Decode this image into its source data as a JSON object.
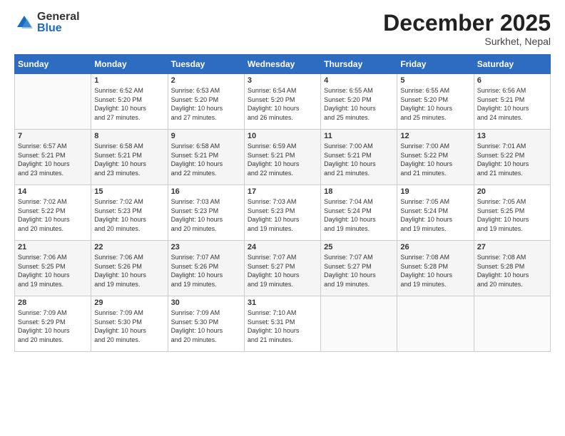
{
  "logo": {
    "general": "General",
    "blue": "Blue"
  },
  "title": "December 2025",
  "subtitle": "Surkhet, Nepal",
  "days_header": [
    "Sunday",
    "Monday",
    "Tuesday",
    "Wednesday",
    "Thursday",
    "Friday",
    "Saturday"
  ],
  "weeks": [
    [
      {
        "day": "",
        "info": ""
      },
      {
        "day": "1",
        "info": "Sunrise: 6:52 AM\nSunset: 5:20 PM\nDaylight: 10 hours\nand 27 minutes."
      },
      {
        "day": "2",
        "info": "Sunrise: 6:53 AM\nSunset: 5:20 PM\nDaylight: 10 hours\nand 27 minutes."
      },
      {
        "day": "3",
        "info": "Sunrise: 6:54 AM\nSunset: 5:20 PM\nDaylight: 10 hours\nand 26 minutes."
      },
      {
        "day": "4",
        "info": "Sunrise: 6:55 AM\nSunset: 5:20 PM\nDaylight: 10 hours\nand 25 minutes."
      },
      {
        "day": "5",
        "info": "Sunrise: 6:55 AM\nSunset: 5:20 PM\nDaylight: 10 hours\nand 25 minutes."
      },
      {
        "day": "6",
        "info": "Sunrise: 6:56 AM\nSunset: 5:21 PM\nDaylight: 10 hours\nand 24 minutes."
      }
    ],
    [
      {
        "day": "7",
        "info": "Sunrise: 6:57 AM\nSunset: 5:21 PM\nDaylight: 10 hours\nand 23 minutes."
      },
      {
        "day": "8",
        "info": "Sunrise: 6:58 AM\nSunset: 5:21 PM\nDaylight: 10 hours\nand 23 minutes."
      },
      {
        "day": "9",
        "info": "Sunrise: 6:58 AM\nSunset: 5:21 PM\nDaylight: 10 hours\nand 22 minutes."
      },
      {
        "day": "10",
        "info": "Sunrise: 6:59 AM\nSunset: 5:21 PM\nDaylight: 10 hours\nand 22 minutes."
      },
      {
        "day": "11",
        "info": "Sunrise: 7:00 AM\nSunset: 5:21 PM\nDaylight: 10 hours\nand 21 minutes."
      },
      {
        "day": "12",
        "info": "Sunrise: 7:00 AM\nSunset: 5:22 PM\nDaylight: 10 hours\nand 21 minutes."
      },
      {
        "day": "13",
        "info": "Sunrise: 7:01 AM\nSunset: 5:22 PM\nDaylight: 10 hours\nand 21 minutes."
      }
    ],
    [
      {
        "day": "14",
        "info": "Sunrise: 7:02 AM\nSunset: 5:22 PM\nDaylight: 10 hours\nand 20 minutes."
      },
      {
        "day": "15",
        "info": "Sunrise: 7:02 AM\nSunset: 5:23 PM\nDaylight: 10 hours\nand 20 minutes."
      },
      {
        "day": "16",
        "info": "Sunrise: 7:03 AM\nSunset: 5:23 PM\nDaylight: 10 hours\nand 20 minutes."
      },
      {
        "day": "17",
        "info": "Sunrise: 7:03 AM\nSunset: 5:23 PM\nDaylight: 10 hours\nand 19 minutes."
      },
      {
        "day": "18",
        "info": "Sunrise: 7:04 AM\nSunset: 5:24 PM\nDaylight: 10 hours\nand 19 minutes."
      },
      {
        "day": "19",
        "info": "Sunrise: 7:05 AM\nSunset: 5:24 PM\nDaylight: 10 hours\nand 19 minutes."
      },
      {
        "day": "20",
        "info": "Sunrise: 7:05 AM\nSunset: 5:25 PM\nDaylight: 10 hours\nand 19 minutes."
      }
    ],
    [
      {
        "day": "21",
        "info": "Sunrise: 7:06 AM\nSunset: 5:25 PM\nDaylight: 10 hours\nand 19 minutes."
      },
      {
        "day": "22",
        "info": "Sunrise: 7:06 AM\nSunset: 5:26 PM\nDaylight: 10 hours\nand 19 minutes."
      },
      {
        "day": "23",
        "info": "Sunrise: 7:07 AM\nSunset: 5:26 PM\nDaylight: 10 hours\nand 19 minutes."
      },
      {
        "day": "24",
        "info": "Sunrise: 7:07 AM\nSunset: 5:27 PM\nDaylight: 10 hours\nand 19 minutes."
      },
      {
        "day": "25",
        "info": "Sunrise: 7:07 AM\nSunset: 5:27 PM\nDaylight: 10 hours\nand 19 minutes."
      },
      {
        "day": "26",
        "info": "Sunrise: 7:08 AM\nSunset: 5:28 PM\nDaylight: 10 hours\nand 19 minutes."
      },
      {
        "day": "27",
        "info": "Sunrise: 7:08 AM\nSunset: 5:28 PM\nDaylight: 10 hours\nand 20 minutes."
      }
    ],
    [
      {
        "day": "28",
        "info": "Sunrise: 7:09 AM\nSunset: 5:29 PM\nDaylight: 10 hours\nand 20 minutes."
      },
      {
        "day": "29",
        "info": "Sunrise: 7:09 AM\nSunset: 5:30 PM\nDaylight: 10 hours\nand 20 minutes."
      },
      {
        "day": "30",
        "info": "Sunrise: 7:09 AM\nSunset: 5:30 PM\nDaylight: 10 hours\nand 20 minutes."
      },
      {
        "day": "31",
        "info": "Sunrise: 7:10 AM\nSunset: 5:31 PM\nDaylight: 10 hours\nand 21 minutes."
      },
      {
        "day": "",
        "info": ""
      },
      {
        "day": "",
        "info": ""
      },
      {
        "day": "",
        "info": ""
      }
    ]
  ]
}
